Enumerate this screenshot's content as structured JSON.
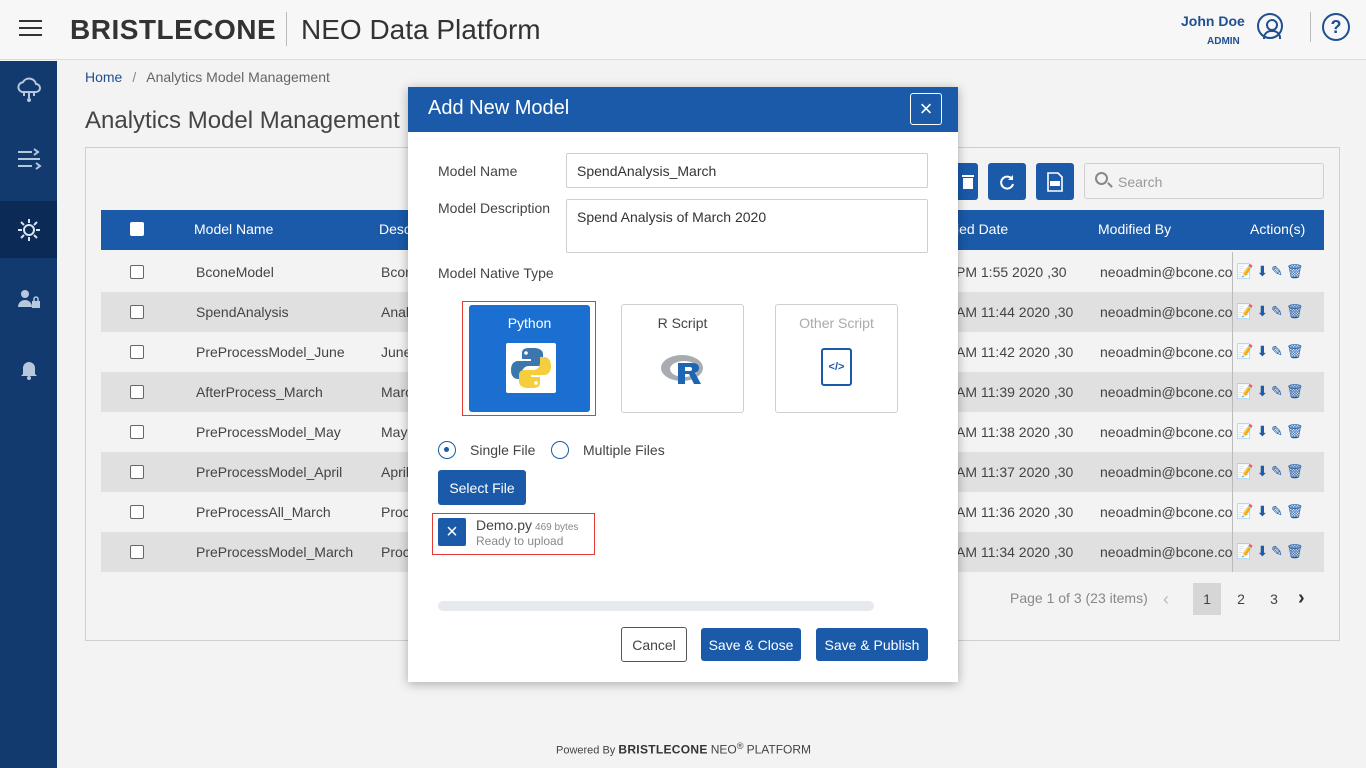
{
  "header": {
    "brand": "BRISTLECONE",
    "platform": "NEO Data Platform",
    "user_name": "John Doe",
    "user_role": "ADMIN",
    "help": "?"
  },
  "sidebar": {
    "items": [
      {
        "icon": "cloud-network-icon",
        "glyph": "☁"
      },
      {
        "icon": "data-flow-icon",
        "glyph": "⇶"
      },
      {
        "icon": "model-gear-icon",
        "glyph": "⚙",
        "active": true
      },
      {
        "icon": "user-lock-icon",
        "glyph": "👤"
      },
      {
        "icon": "bell-icon",
        "glyph": "🔔"
      }
    ]
  },
  "breadcrumb": {
    "home": "Home",
    "separator": "/",
    "current": "Analytics Model Management"
  },
  "page_title": "Analytics Model Management",
  "search": {
    "placeholder": "Search"
  },
  "table": {
    "columns": {
      "name": "Model Name",
      "desc": "Desc",
      "modified_date": "ied Date",
      "modified_by": "Modified By",
      "actions": "Action(s)"
    },
    "rows": [
      {
        "name": "BconeModel",
        "desc": "Bcon",
        "date": "30, 2020 1:55 PM",
        "by": "neoadmin@bcone.co"
      },
      {
        "name": "SpendAnalysis",
        "desc": "Anal",
        "date": "30, 2020 11:44 AM",
        "by": "neoadmin@bcone.co"
      },
      {
        "name": "PreProcessModel_June",
        "desc": "June",
        "date": "30, 2020 11:42 AM",
        "by": "neoadmin@bcone.co"
      },
      {
        "name": "AfterProcess_March",
        "desc": "Marc",
        "date": "30, 2020 11:39 AM",
        "by": "neoadmin@bcone.co"
      },
      {
        "name": "PreProcessModel_May",
        "desc": "May",
        "date": "30, 2020 11:38 AM",
        "by": "neoadmin@bcone.co"
      },
      {
        "name": "PreProcessModel_April",
        "desc": "April",
        "date": "30, 2020 11:37 AM",
        "by": "neoadmin@bcone.co"
      },
      {
        "name": "PreProcessAll_March",
        "desc": "Proc",
        "date": "30, 2020 11:36 AM",
        "by": "neoadmin@bcone.co"
      },
      {
        "name": "PreProcessModel_March",
        "desc": "Proc",
        "date": "30, 2020 11:34 AM",
        "by": "neoadmin@bcone.co"
      }
    ]
  },
  "pager": {
    "info": "Page 1 of 3 (23 items)",
    "pages": [
      "1",
      "2",
      "3"
    ],
    "current": "1"
  },
  "footer": {
    "powered_by": "Powered By",
    "brand": "BRISTLECONE",
    "neo": "NEO",
    "reg": "®",
    "platform": "PLATFORM"
  },
  "modal": {
    "title": "Add New Model",
    "close": "×",
    "model_name_label": "Model Name",
    "model_name_value": "SpendAnalysis_March",
    "model_desc_label": "Model Description",
    "model_desc_value": "Spend Analysis of March 2020",
    "native_type_label": "Model Native Type",
    "types": [
      {
        "label": "Python",
        "icon": "python-logo-icon",
        "selected": true
      },
      {
        "label": "R Script",
        "icon": "r-logo-icon",
        "selected": false
      },
      {
        "label": "Other Script",
        "icon": "code-file-icon",
        "disabled": true
      }
    ],
    "single_file_label": "Single File",
    "multiple_files_label": "Multiple Files",
    "upload_mode": "single",
    "select_file_label": "Select File",
    "file": {
      "name": "Demo.py",
      "size": "469 bytes",
      "status": "Ready to upload"
    },
    "cancel_label": "Cancel",
    "save_close_label": "Save & Close",
    "save_publish_label": "Save & Publish"
  },
  "colors": {
    "primary": "#1a5aa8",
    "sidebar": "#123a6e",
    "highlight": "#e53935"
  }
}
